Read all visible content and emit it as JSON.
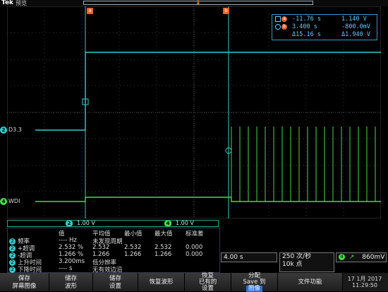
{
  "topbar": {
    "brand": "Tek",
    "mode": "预览"
  },
  "cursor_labels": {
    "a": "a",
    "b": "b"
  },
  "readout": {
    "row1": {
      "v1": "-11.76 s",
      "v2": "1.140 V"
    },
    "row2": {
      "v1": "3.400 s",
      "v2": "-800.0mV"
    },
    "row3": {
      "v1": "Δ15.16 s",
      "v2": "Δ1.940 V"
    }
  },
  "channels": [
    {
      "num": "2",
      "label": "D3.3",
      "color": "#3cc"
    },
    {
      "num": "4",
      "label": "WDI",
      "color": "#4d4"
    }
  ],
  "scale_bar": {
    "ch2_num": "2",
    "ch2_scale": "1.00 V",
    "ch4_num": "4",
    "ch4_scale": "1.00 V"
  },
  "measurements": {
    "headers": [
      "值",
      "平均值",
      "最小值",
      "最大值",
      "标准差"
    ],
    "rows": [
      {
        "ch": "2",
        "name": "频率",
        "value": "---- Hz",
        "mean": "未发现周期",
        "min": "",
        "max": "",
        "std": ""
      },
      {
        "ch": "2",
        "name": "+超调",
        "value": "2.532 %",
        "mean": "2.532",
        "min": "2.532",
        "max": "2.532",
        "std": "0.000"
      },
      {
        "ch": "2",
        "name": "-超调",
        "value": "1.266 %",
        "mean": "1.266",
        "min": "1.266",
        "max": "1.266",
        "std": "0.000"
      },
      {
        "ch": "2",
        "name": "上升时间",
        "value": "3.200ms",
        "mean": "低分辨率",
        "min": "",
        "max": "",
        "std": ""
      },
      {
        "ch": "2",
        "name": "下降时间",
        "value": "---- s",
        "mean": "无有效边沿",
        "min": "",
        "max": "",
        "std": ""
      }
    ]
  },
  "status": {
    "timebase": "4.00 s",
    "acq_line1": "250 次/秒",
    "acq_line2": "10k 点",
    "trig_ch": "4",
    "trig_level": "860mV"
  },
  "menu": [
    {
      "line1": "保存",
      "line2": "屏幕图像"
    },
    {
      "line1": "储存",
      "line2": "波形"
    },
    {
      "line1": "储存",
      "line2": "设置"
    },
    {
      "line1": "恢复波形",
      "line2": ""
    },
    {
      "line1": "恢复",
      "line2": "已有的",
      "line3": "设置"
    },
    {
      "line1": "分配",
      "line2": "Save 到",
      "line3": "图像"
    },
    {
      "line1": "文件功能",
      "line2": ""
    }
  ],
  "datetime": {
    "date": "17 1月 2017",
    "time": "11:29:50"
  }
}
